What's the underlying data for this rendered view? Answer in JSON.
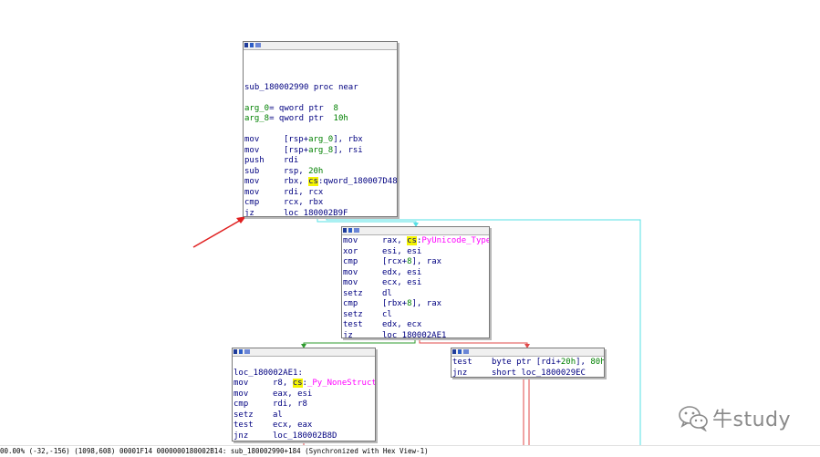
{
  "colors": {
    "background": "#ffffff",
    "node_border": "#7a7a7a",
    "code_text": "#000080",
    "arg_green": "#008000",
    "highlight_yellow": "#f4f400",
    "symbol_magenta": "#ff00ff",
    "edge_green": "#2e9b2e",
    "edge_red": "#e04848",
    "edge_cyan": "#56e0e6",
    "annotation_arrow": "#e02020"
  },
  "nodes": {
    "block1": {
      "proc_line": "sub_180002990 proc near",
      "args": [
        {
          "name": "arg_0",
          "rest": "= qword ptr  ",
          "num": "8"
        },
        {
          "name": "arg_8",
          "rest": "= qword ptr  ",
          "num": "10h"
        }
      ],
      "instructions": [
        {
          "mn": "mov",
          "parts": [
            {
              "t": "[rsp+",
              "c": ""
            },
            {
              "t": "arg_0",
              "c": "arg"
            },
            {
              "t": "], rbx",
              "c": ""
            }
          ]
        },
        {
          "mn": "mov",
          "parts": [
            {
              "t": "[rsp+",
              "c": ""
            },
            {
              "t": "arg_8",
              "c": "arg"
            },
            {
              "t": "], rsi",
              "c": ""
            }
          ]
        },
        {
          "mn": "push",
          "parts": [
            {
              "t": "rdi",
              "c": ""
            }
          ]
        },
        {
          "mn": "sub",
          "parts": [
            {
              "t": "rsp, ",
              "c": ""
            },
            {
              "t": "20h",
              "c": "num"
            }
          ]
        },
        {
          "mn": "mov",
          "parts": [
            {
              "t": "rbx, ",
              "c": ""
            },
            {
              "t": "cs",
              "c": "cs"
            },
            {
              "t": ":qword_180007D48",
              "c": ""
            }
          ]
        },
        {
          "mn": "mov",
          "parts": [
            {
              "t": "rdi, rcx",
              "c": ""
            }
          ]
        },
        {
          "mn": "cmp",
          "parts": [
            {
              "t": "rcx, rbx",
              "c": ""
            }
          ]
        },
        {
          "mn": "jz",
          "parts": [
            {
              "t": "loc_180002B9F",
              "c": ""
            }
          ]
        }
      ]
    },
    "block2": {
      "instructions": [
        {
          "mn": "mov",
          "parts": [
            {
              "t": "rax, ",
              "c": ""
            },
            {
              "t": "cs",
              "c": "cs"
            },
            {
              "t": ":",
              "c": ""
            },
            {
              "t": "PyUnicode_Type",
              "c": "sym"
            }
          ]
        },
        {
          "mn": "xor",
          "parts": [
            {
              "t": "esi, esi",
              "c": ""
            }
          ]
        },
        {
          "mn": "cmp",
          "parts": [
            {
              "t": "[rcx+",
              "c": ""
            },
            {
              "t": "8",
              "c": "num"
            },
            {
              "t": "], rax",
              "c": ""
            }
          ]
        },
        {
          "mn": "mov",
          "parts": [
            {
              "t": "edx, esi",
              "c": ""
            }
          ]
        },
        {
          "mn": "mov",
          "parts": [
            {
              "t": "ecx, esi",
              "c": ""
            }
          ]
        },
        {
          "mn": "setz",
          "parts": [
            {
              "t": "dl",
              "c": ""
            }
          ]
        },
        {
          "mn": "cmp",
          "parts": [
            {
              "t": "[rbx+",
              "c": ""
            },
            {
              "t": "8",
              "c": "num"
            },
            {
              "t": "], rax",
              "c": ""
            }
          ]
        },
        {
          "mn": "setz",
          "parts": [
            {
              "t": "cl",
              "c": ""
            }
          ]
        },
        {
          "mn": "test",
          "parts": [
            {
              "t": "edx, ecx",
              "c": ""
            }
          ]
        },
        {
          "mn": "jz",
          "parts": [
            {
              "t": "loc_180002AE1",
              "c": ""
            }
          ]
        }
      ]
    },
    "block3": {
      "label": "loc_180002AE1:",
      "instructions": [
        {
          "mn": "mov",
          "parts": [
            {
              "t": "r8, ",
              "c": ""
            },
            {
              "t": "cs",
              "c": "cs"
            },
            {
              "t": ":",
              "c": ""
            },
            {
              "t": "_Py_NoneStruct",
              "c": "sym"
            }
          ]
        },
        {
          "mn": "mov",
          "parts": [
            {
              "t": "eax, esi",
              "c": ""
            }
          ]
        },
        {
          "mn": "cmp",
          "parts": [
            {
              "t": "rdi, r8",
              "c": ""
            }
          ]
        },
        {
          "mn": "setz",
          "parts": [
            {
              "t": "al",
              "c": ""
            }
          ]
        },
        {
          "mn": "test",
          "parts": [
            {
              "t": "ecx, eax",
              "c": ""
            }
          ]
        },
        {
          "mn": "jnz",
          "parts": [
            {
              "t": "loc_180002B8D",
              "c": ""
            }
          ]
        }
      ]
    },
    "block4": {
      "instructions": [
        {
          "mn": "test",
          "parts": [
            {
              "t": "byte ptr [rdi+",
              "c": ""
            },
            {
              "t": "20h",
              "c": "num"
            },
            {
              "t": "], ",
              "c": ""
            },
            {
              "t": "80h",
              "c": "num"
            }
          ]
        },
        {
          "mn": "jnz",
          "parts": [
            {
              "t": "short loc_1800029EC",
              "c": ""
            }
          ]
        }
      ]
    }
  },
  "status_bar": {
    "text": "00.00% (-32,-156) (1098,608) 00001F14 0000000180002B14: sub_180002990+184 (Synchronized with Hex View-1)"
  },
  "watermark": {
    "icon": "wechat-logo-icon",
    "text": "牛study"
  }
}
